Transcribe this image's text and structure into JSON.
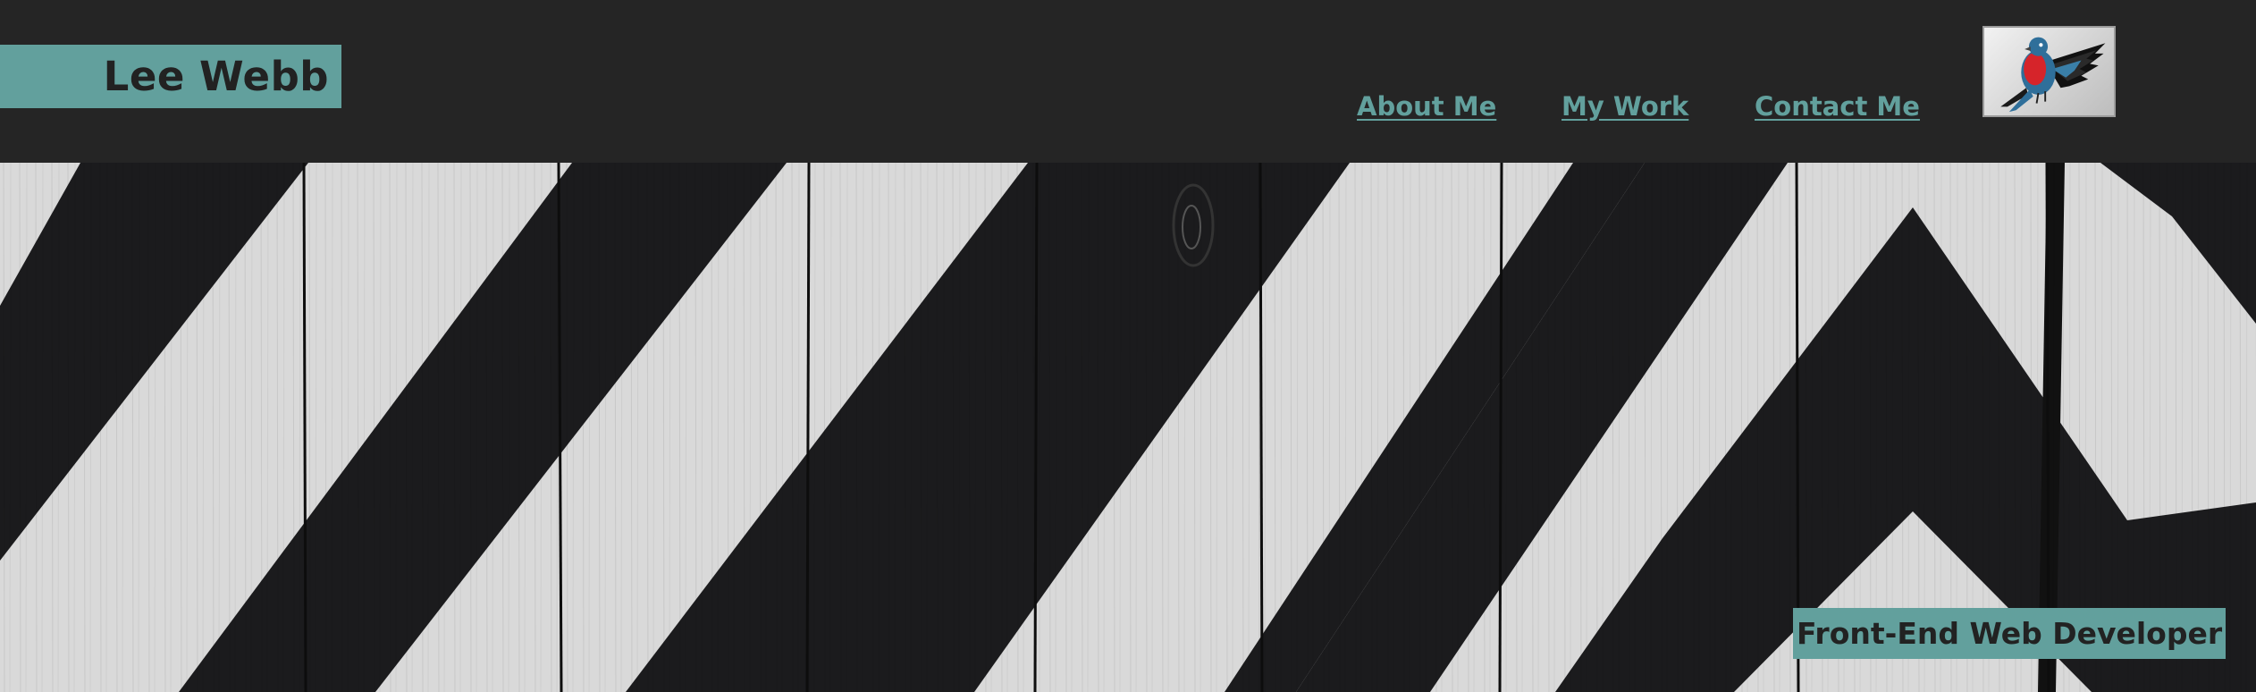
{
  "brand": {
    "name": "Lee Webb"
  },
  "nav": {
    "items": [
      {
        "label": "About Me"
      },
      {
        "label": "My Work"
      },
      {
        "label": "Contact Me"
      }
    ]
  },
  "logo": {
    "icon": "bird-icon"
  },
  "hero": {
    "tagline": "Front-End Web Developer",
    "image": "black-and-white-striped-wood-fence"
  },
  "colors": {
    "header_bg": "#252525",
    "accent": "#62a09d",
    "text_dark": "#222222",
    "stripe_dark": "#1b1b1d",
    "stripe_light": "#d8d8d8"
  }
}
